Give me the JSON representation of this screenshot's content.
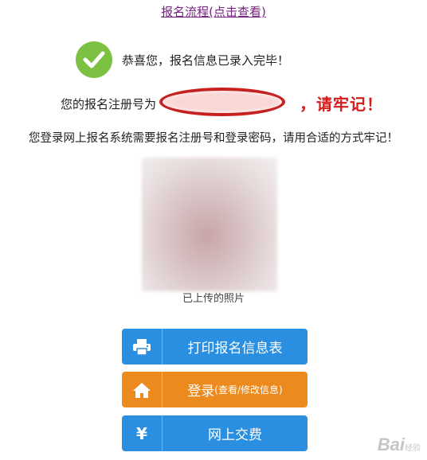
{
  "header": {
    "process_link": "报名流程(点击查看)"
  },
  "success": {
    "message": "恭喜您，报名信息已录入完毕！"
  },
  "registration": {
    "label": "您的报名注册号为",
    "remember": "，请牢记！"
  },
  "notice": "您登录网上报名系统需要报名注册号和登录密码，请用合适的方式牢记！",
  "photo": {
    "caption": "已上传的照片"
  },
  "buttons": {
    "print": {
      "label": "打印报名信息表",
      "icon": "printer-icon"
    },
    "login": {
      "label": "登录",
      "sub": "(查看/修改信息)",
      "icon": "home-icon"
    },
    "pay": {
      "label": "网上交费",
      "icon": "yen-icon",
      "glyph": "¥"
    }
  },
  "watermark": {
    "text": "Bai",
    "sub": "经验"
  },
  "colors": {
    "link": "#7a1f86",
    "check_green": "#7cc142",
    "highlight_red": "#d61b1b",
    "button_blue": "#2a8fe0",
    "button_orange": "#ec8a1e"
  }
}
